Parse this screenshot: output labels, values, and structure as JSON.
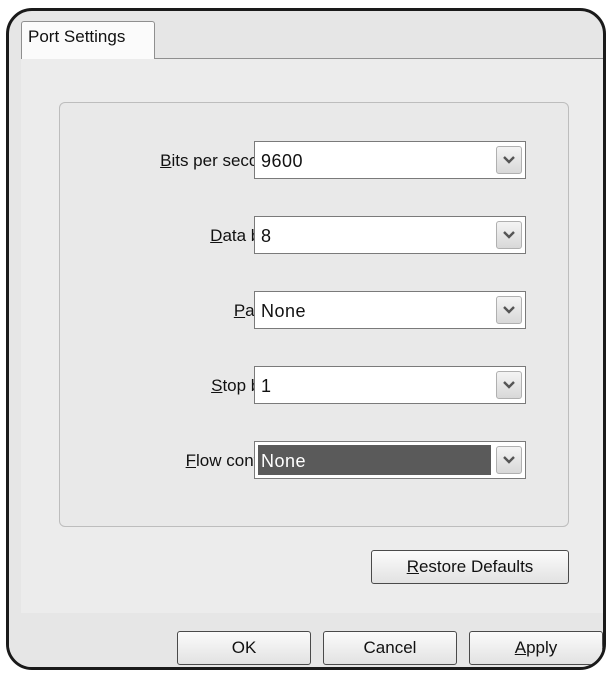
{
  "tab": {
    "label": "Port Settings"
  },
  "fields": [
    {
      "mnemonic": "B",
      "rest": "its per second:",
      "value": "9600"
    },
    {
      "mnemonic": "D",
      "rest": "ata bits:",
      "value": "8"
    },
    {
      "mnemonic": "P",
      "rest": "arity:",
      "value": "None"
    },
    {
      "mnemonic": "S",
      "rest": "top bits:",
      "value": "1"
    },
    {
      "mnemonic": "F",
      "rest": "low control:",
      "value": "None"
    }
  ],
  "buttons": {
    "restore": {
      "mnemonic": "R",
      "rest": "estore Defaults"
    },
    "ok": {
      "label": "OK"
    },
    "cancel": {
      "label": "Cancel"
    },
    "apply": {
      "mnemonic": "A",
      "rest": "pply"
    }
  }
}
